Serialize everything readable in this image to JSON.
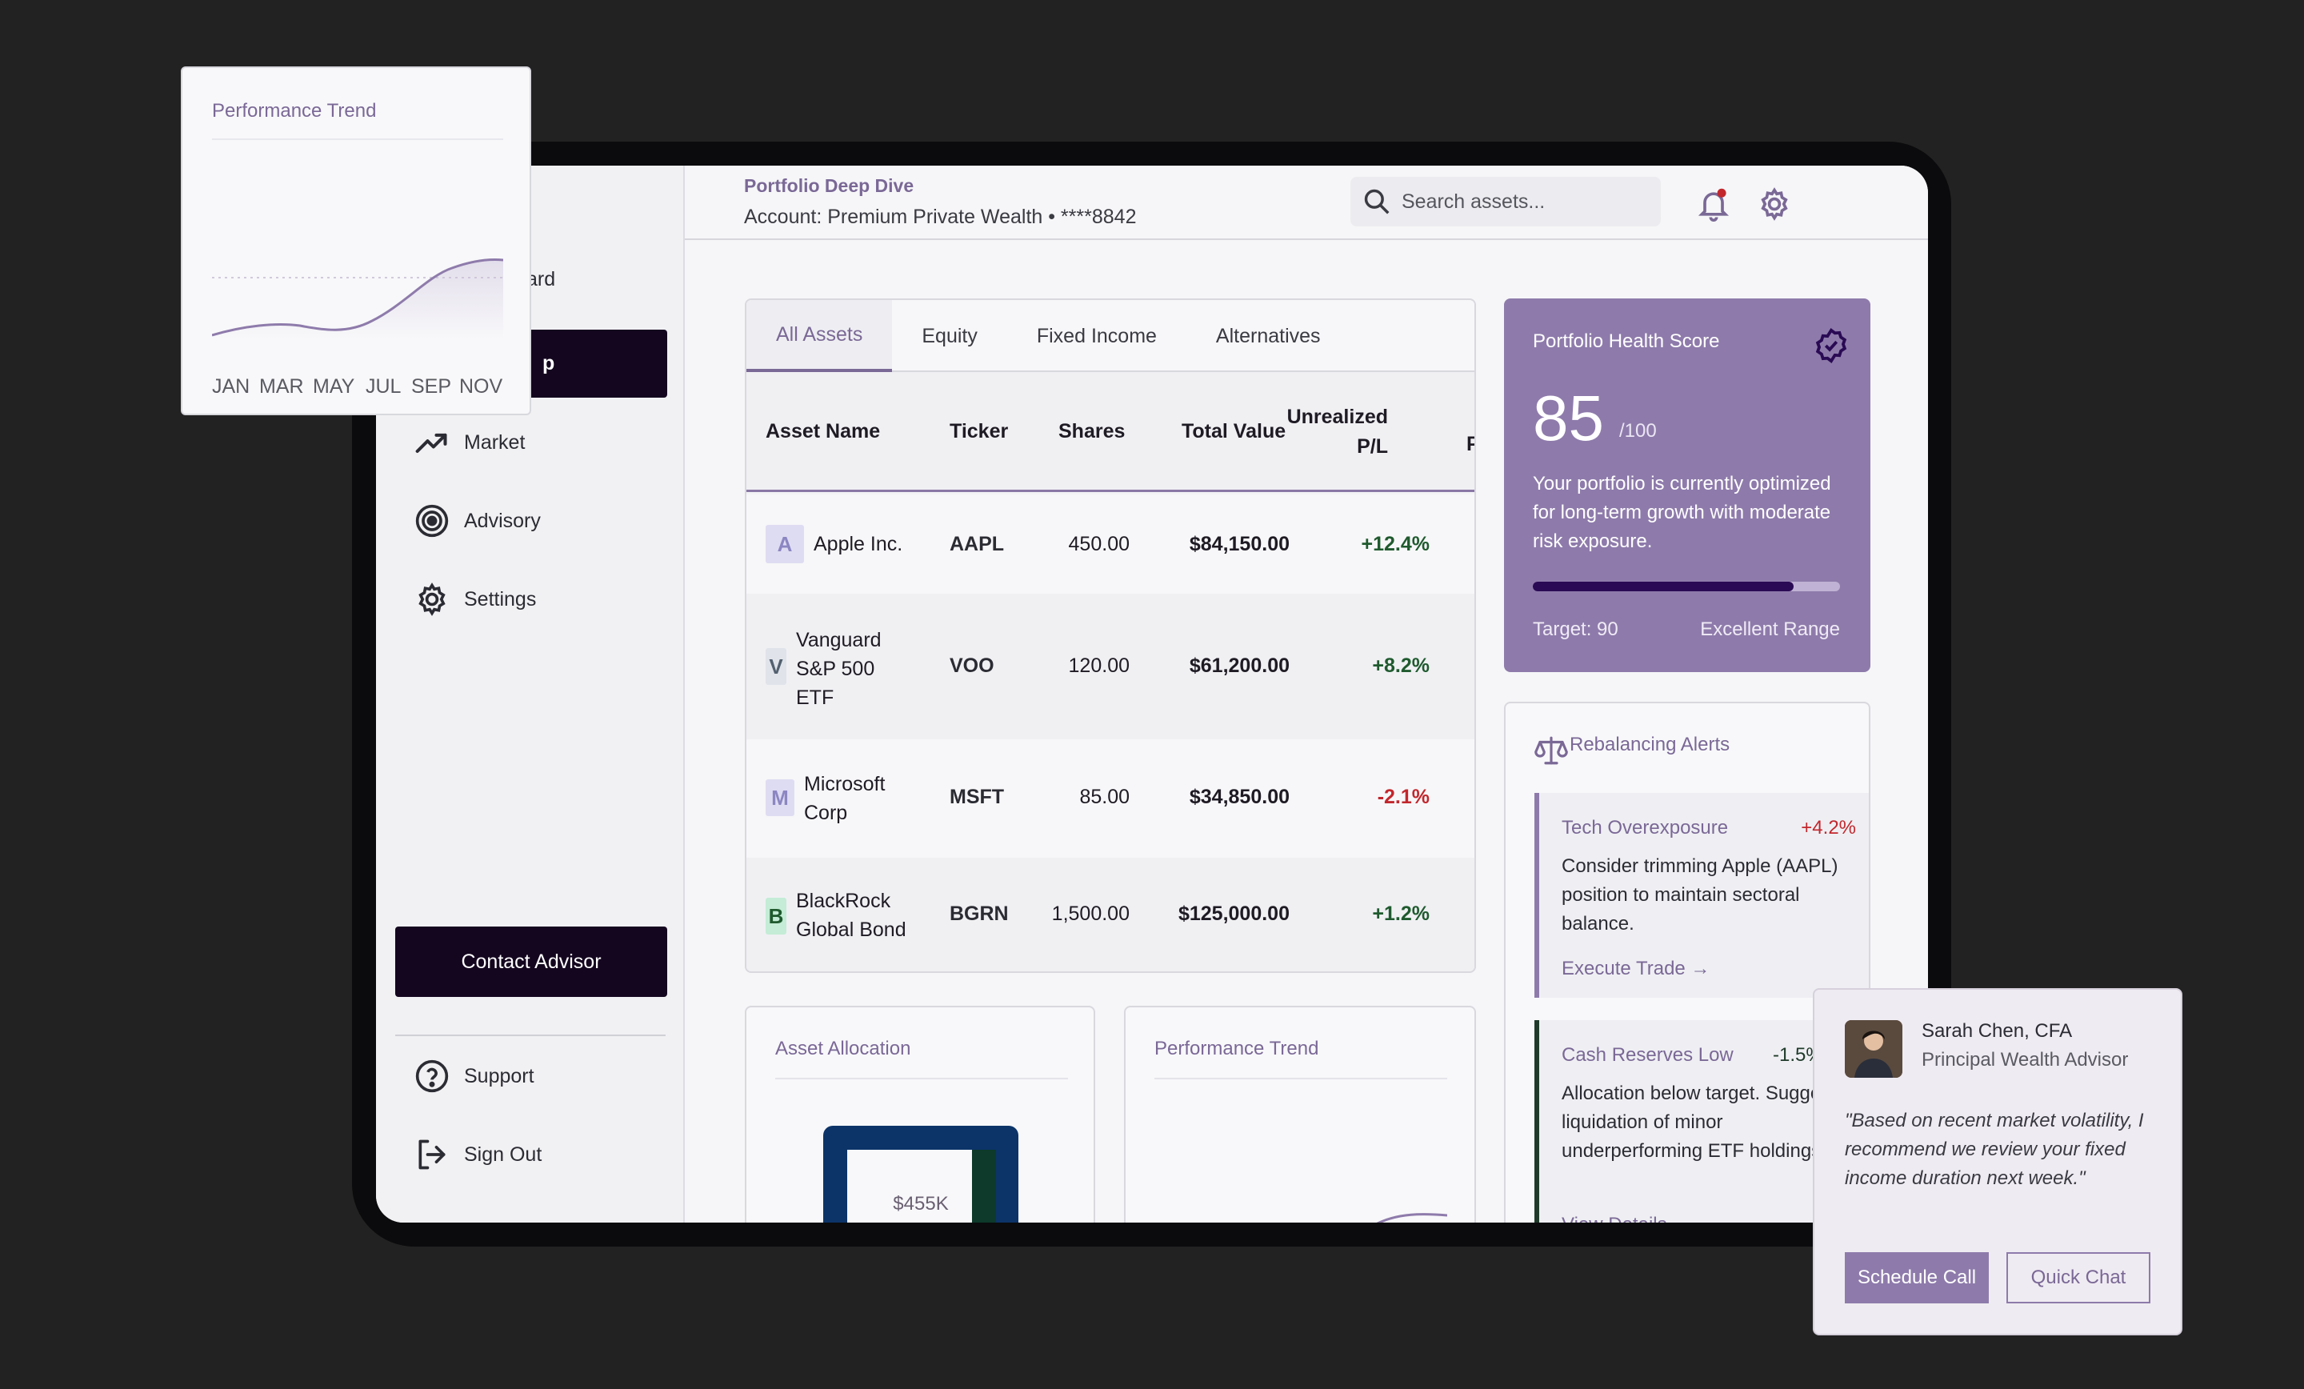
{
  "header": {
    "title": "Portfolio Deep Dive",
    "account": "Account: Premium Private Wealth • ****8842",
    "search_placeholder": "Search assets..."
  },
  "sidebar": {
    "partial_item": "ard",
    "active_item": "p",
    "items": [
      {
        "label": "Market",
        "icon": "trending-up-icon"
      },
      {
        "label": "Advisory",
        "icon": "target-icon"
      },
      {
        "label": "Settings",
        "icon": "gear-icon"
      }
    ],
    "contact_label": "Contact Advisor",
    "footer_items": [
      {
        "label": "Support",
        "icon": "help-icon"
      },
      {
        "label": "Sign Out",
        "icon": "sign-out-icon"
      }
    ]
  },
  "tabs": [
    "All Assets",
    "Equity",
    "Fixed Income",
    "Alternatives"
  ],
  "table": {
    "headers": {
      "asset": "Asset Name",
      "ticker": "Ticker",
      "shares": "Shares",
      "total": "Total Value",
      "pl_line1": "Unrealized",
      "pl_line2": "P/L",
      "extra": "P"
    },
    "rows": [
      {
        "badge": "A",
        "name": [
          "Apple Inc."
        ],
        "ticker": "AAPL",
        "shares": "450.00",
        "total": "$84,150.00",
        "pl": "+12.4%"
      },
      {
        "badge": "V",
        "name": [
          "Vanguard",
          "S&P 500",
          "ETF"
        ],
        "ticker": "VOO",
        "shares": "120.00",
        "total": "$61,200.00",
        "pl": "+8.2%"
      },
      {
        "badge": "M",
        "name": [
          "Microsoft",
          "Corp"
        ],
        "ticker": "MSFT",
        "shares": "85.00",
        "total": "$34,850.00",
        "pl": "-2.1%"
      },
      {
        "badge": "B",
        "name": [
          "BlackRock",
          "Global Bond"
        ],
        "ticker": "BGRN",
        "shares": "1,500.00",
        "total": "$125,000.00",
        "pl": "+1.2%"
      }
    ]
  },
  "allocation": {
    "title": "Asset Allocation",
    "center_value": "$455K"
  },
  "performance_card": {
    "title": "Performance Trend"
  },
  "health": {
    "title": "Portfolio Health Score",
    "score": "85",
    "max": "/100",
    "description": "Your portfolio is currently optimized for long-term growth with moderate risk exposure.",
    "progress": 0.85,
    "target": "Target: 90",
    "range": "Excellent Range"
  },
  "alerts": {
    "title": "Rebalancing Alerts",
    "items": [
      {
        "title": "Tech Overexposure",
        "pct": "+4.2%",
        "body": "Consider trimming Apple (AAPL) position to maintain sectoral balance.",
        "link": "Execute Trade →"
      },
      {
        "title": "Cash Reserves Low",
        "pct": "-1.5%",
        "body": "Allocation below target. Suggest liquidation of minor underperforming ETF holdings.",
        "link": "View Details →"
      }
    ]
  },
  "floating_trend": {
    "title": "Performance Trend",
    "months": [
      "JAN",
      "MAR",
      "MAY",
      "JUL",
      "SEP",
      "NOV"
    ]
  },
  "advisor": {
    "name": "Sarah Chen, CFA",
    "role": "Principal Wealth Advisor",
    "quote": "\"Based on recent market volatility, I recommend we review your fixed income duration next week.\"",
    "schedule_label": "Schedule Call",
    "chat_label": "Quick Chat"
  },
  "colors": {
    "accent": "#8e7bab",
    "accent_text": "#7a6896",
    "dark": "#14061f",
    "positive": "#1f5a2e",
    "negative": "#c2272d"
  }
}
